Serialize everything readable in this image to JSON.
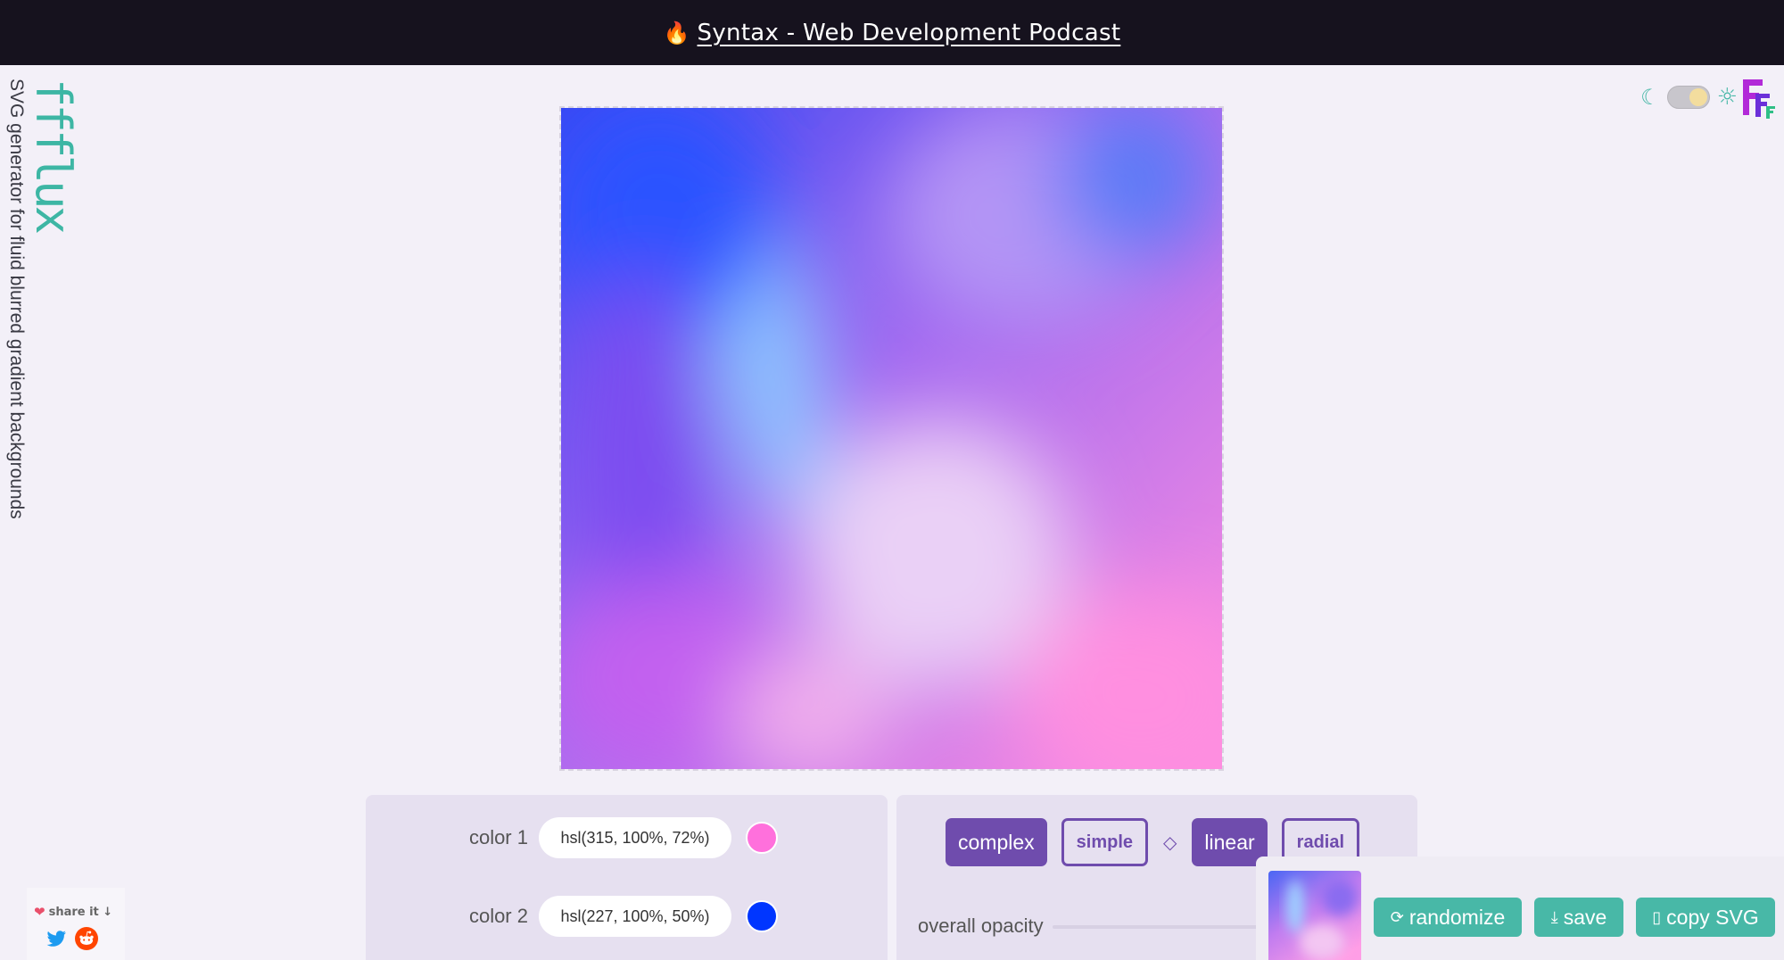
{
  "topbar": {
    "icon": "fire-icon",
    "link_text": "Syntax - Web Development Podcast"
  },
  "brand": {
    "name": "ffflux",
    "tagline": "SVG generator for fluid blurred gradient backgrounds"
  },
  "theme_toggle": {
    "moon_icon": "moon-icon",
    "sun_icon": "sun-icon",
    "state": "light"
  },
  "colors": {
    "color1": {
      "label": "color 1",
      "value": "hsl(315, 100%, 72%)",
      "swatch": "#ff70dc"
    },
    "color2": {
      "label": "color 2",
      "value": "hsl(227, 100%, 50%)",
      "swatch": "#0036ff"
    }
  },
  "mode_buttons": {
    "complex": "complex",
    "simple": "simple",
    "linear": "linear",
    "radial": "radial",
    "separator": "◇"
  },
  "opacity": {
    "label": "overall opacity"
  },
  "actions": {
    "randomize": "randomize",
    "save": "save",
    "copy_svg": "copy SVG"
  },
  "share": {
    "label": "share it ↓",
    "twitter_icon": "twitter-icon",
    "reddit_icon": "reddit-icon"
  },
  "accent_colors": {
    "purple": "#6f4cad",
    "teal": "#48b8a7",
    "topbar": "#16121e"
  }
}
